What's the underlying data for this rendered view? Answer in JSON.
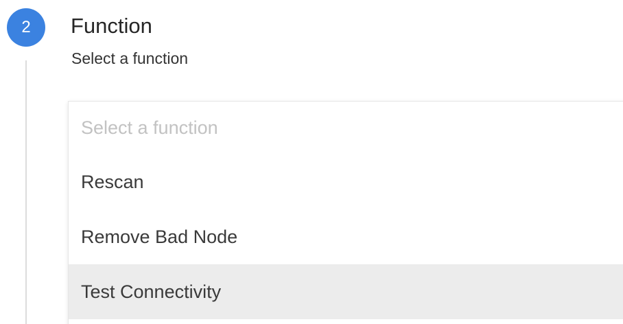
{
  "step": {
    "number": "2",
    "title": "Function",
    "subtitle": "Select a function"
  },
  "dropdown": {
    "placeholder": "Select a function",
    "options": [
      {
        "label": "Rescan",
        "highlighted": false
      },
      {
        "label": "Remove Bad Node",
        "highlighted": false
      },
      {
        "label": "Test Connectivity",
        "highlighted": true
      }
    ]
  },
  "colors": {
    "badge": "#3b82e0",
    "highlight": "#ececec",
    "placeholder_text": "#c2c2c2",
    "text": "#3a3a3a"
  }
}
